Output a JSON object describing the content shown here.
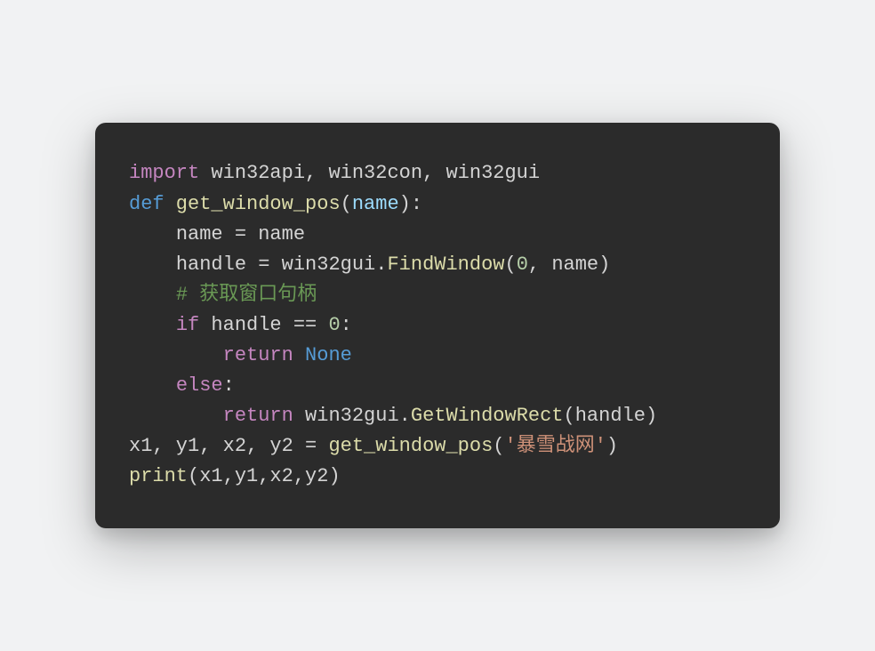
{
  "code": {
    "line1": {
      "kw": "import",
      "modules": " win32api, win32con, win32gui"
    },
    "line2": {
      "kw": "def",
      "fn": " get_window_pos",
      "paren_open": "(",
      "param": "name",
      "paren_close_colon": "):"
    },
    "line3": {
      "indent": "    ",
      "lhs": "name ",
      "op": "=",
      "rhs": " name"
    },
    "line4": {
      "indent": "    ",
      "lhs": "handle ",
      "op": "=",
      "mod": " win32gui.",
      "fn": "FindWindow",
      "paren_open": "(",
      "arg0": "0",
      "comma": ", ",
      "arg1": "name",
      "paren_close": ")"
    },
    "line5": {
      "indent": "    ",
      "comment": "# 获取窗口句柄"
    },
    "line6": {
      "indent": "    ",
      "kw": "if",
      "cond_lhs": " handle ",
      "op": "==",
      "cond_rhs": " ",
      "num": "0",
      "colon": ":"
    },
    "line7": {
      "indent": "        ",
      "kw": "return",
      "sp": " ",
      "val": "None"
    },
    "line8": {
      "indent": "    ",
      "kw": "else",
      "colon": ":"
    },
    "line9": {
      "indent": "        ",
      "kw": "return",
      "mod": " win32gui.",
      "fn": "GetWindowRect",
      "paren_open": "(",
      "arg": "handle",
      "paren_close": ")"
    },
    "line10": {
      "lhs": "x1, y1, x2, y2 ",
      "op": "=",
      "sp": " ",
      "fn": "get_window_pos",
      "paren_open": "(",
      "str": "'暴雪战网'",
      "paren_close": ")"
    },
    "line11": {
      "fn": "print",
      "paren_open": "(",
      "args": "x1,y1,x2,y2",
      "paren_close": ")"
    }
  }
}
